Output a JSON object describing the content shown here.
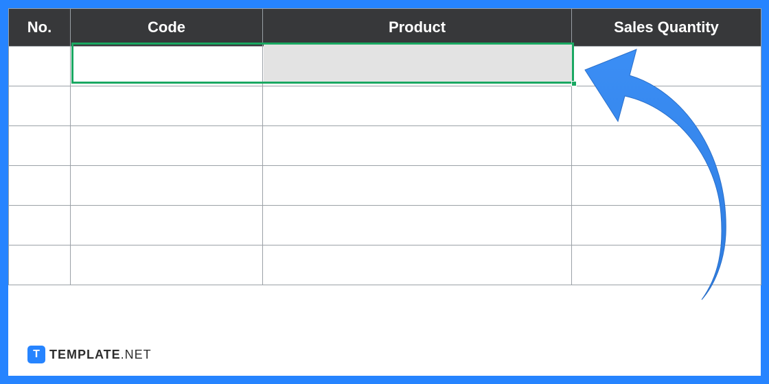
{
  "table": {
    "headers": {
      "no": "No.",
      "code": "Code",
      "product": "Product",
      "qty": "Sales Quantity"
    },
    "rows": [
      {
        "no": "",
        "code": "",
        "product": "",
        "qty": ""
      },
      {
        "no": "",
        "code": "",
        "product": "",
        "qty": ""
      },
      {
        "no": "",
        "code": "",
        "product": "",
        "qty": ""
      },
      {
        "no": "",
        "code": "",
        "product": "",
        "qty": ""
      },
      {
        "no": "",
        "code": "",
        "product": "",
        "qty": ""
      },
      {
        "no": "",
        "code": "",
        "product": "",
        "qty": ""
      }
    ]
  },
  "watermark": {
    "badge_letter": "T",
    "brand_bold": "TEMPLATE",
    "brand_light": ".NET"
  },
  "colors": {
    "frame": "#2684ff",
    "header_bg": "#37383a",
    "selection_border": "#1aa862",
    "arrow": "#2f86f6"
  }
}
